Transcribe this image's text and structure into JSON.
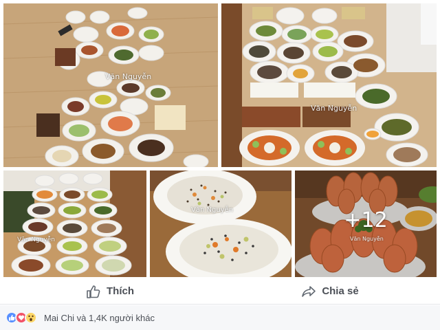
{
  "post": {
    "watermark": "Văn Nguyễn",
    "more_photos": "+12"
  },
  "actions": {
    "like_label": "Thích",
    "share_label": "Chia sẻ"
  },
  "reactions": {
    "icons": [
      "like-icon",
      "love-icon",
      "wow-icon"
    ],
    "summary": "Mai Chi và 1,4K người khác"
  },
  "colors": {
    "like_blue": "#5890ff",
    "love_red": "#f25268",
    "wow_yellow": "#fcd667",
    "action_text": "#4b4f56"
  }
}
